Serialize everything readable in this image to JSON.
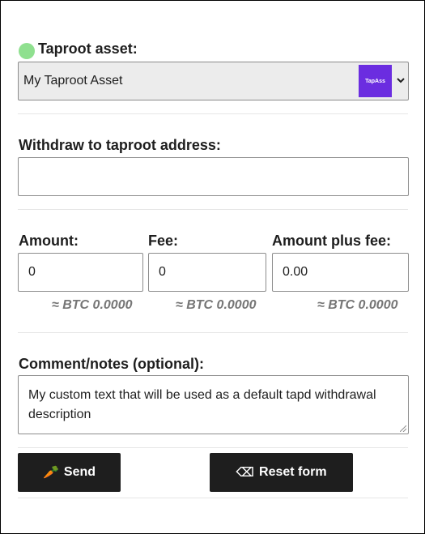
{
  "asset": {
    "label": "Taproot asset:",
    "selected": "My Taproot Asset",
    "logo_text": "TapAss",
    "status_color": "#8fe08f",
    "logo_color": "#6b2de0"
  },
  "withdraw": {
    "label": "Withdraw to taproot address:",
    "value": ""
  },
  "amount": {
    "label": "Amount:",
    "value": "0",
    "btc": "≈ BTC 0.0000"
  },
  "fee": {
    "label": "Fee:",
    "value": "0",
    "btc": "≈ BTC 0.0000"
  },
  "total": {
    "label": "Amount plus fee:",
    "value": "0.00",
    "btc": "≈ BTC 0.0000"
  },
  "comment": {
    "label": "Comment/notes (optional):",
    "value": "My custom text that will be used as a default tapd withdrawal description"
  },
  "buttons": {
    "send_icon": "🥕",
    "send_label": "Send",
    "reset_icon": "⌫",
    "reset_label": "Reset form"
  }
}
